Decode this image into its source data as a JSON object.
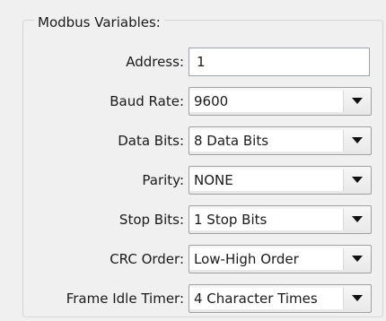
{
  "group": {
    "title": "Modbus Variables:"
  },
  "fields": {
    "address": {
      "label": "Address:",
      "value": "1"
    },
    "baud_rate": {
      "label": "Baud Rate:",
      "value": "9600"
    },
    "data_bits": {
      "label": "Data Bits:",
      "value": "8 Data Bits"
    },
    "parity": {
      "label": "Parity:",
      "value": "NONE"
    },
    "stop_bits": {
      "label": "Stop Bits:",
      "value": "1 Stop Bits"
    },
    "crc_order": {
      "label": "CRC Order:",
      "value": "Low-High Order"
    },
    "frame_idle_timer": {
      "label": "Frame Idle Timer:",
      "value": "4 Character Times"
    }
  },
  "icons": {
    "dropdown": "chevron-down-icon"
  }
}
